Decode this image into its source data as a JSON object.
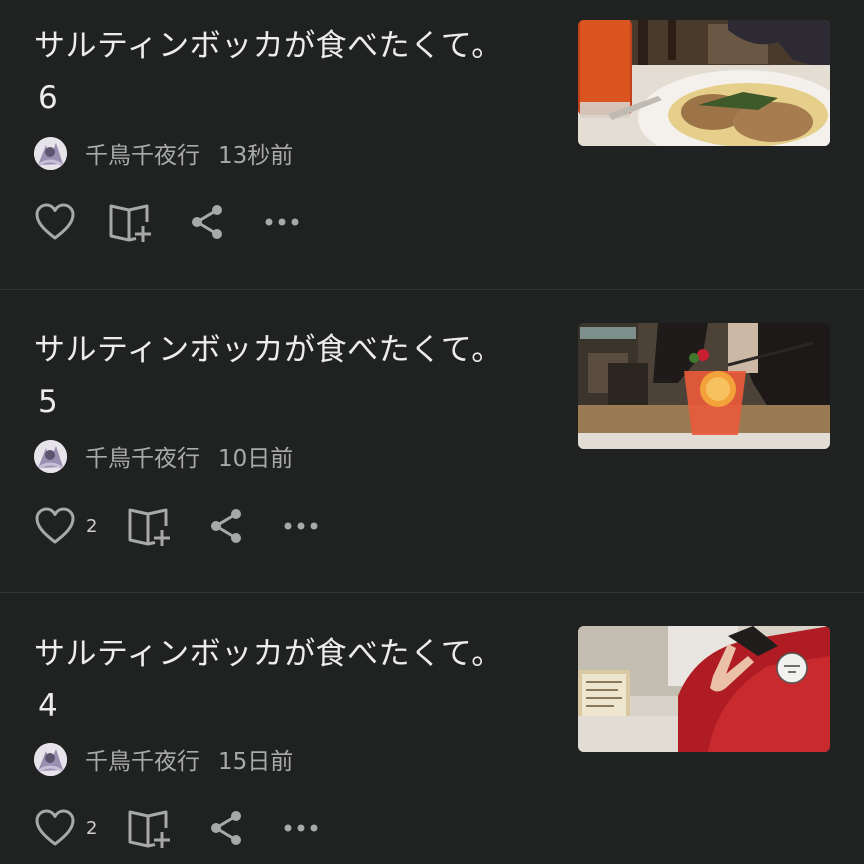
{
  "posts": [
    {
      "title": "サルティンボッカが食べたくて。",
      "number": "6",
      "author": "千鳥千夜行",
      "time": "13秒前",
      "likes": "",
      "thumb_desc": "plate of saltimbocca with a glass of tomato juice"
    },
    {
      "title": "サルティンボッカが食べたくて。",
      "number": "5",
      "author": "千鳥千夜行",
      "time": "10日前",
      "likes": "2",
      "thumb_desc": "red-orange cocktail with orange slice"
    },
    {
      "title": "サルティンボッカが食べたくて。",
      "number": "4",
      "author": "千鳥千夜行",
      "time": "15日前",
      "likes": "2",
      "thumb_desc": "person in red sweater making peace sign"
    }
  ],
  "icons": {
    "like": "heart-icon",
    "save": "book-plus-icon",
    "share": "share-icon",
    "more": "ellipsis-icon"
  },
  "colors": {
    "background": "#202121",
    "text": "#ececec",
    "meta": "#a9aaaa",
    "icon": "#a7a8a8"
  }
}
